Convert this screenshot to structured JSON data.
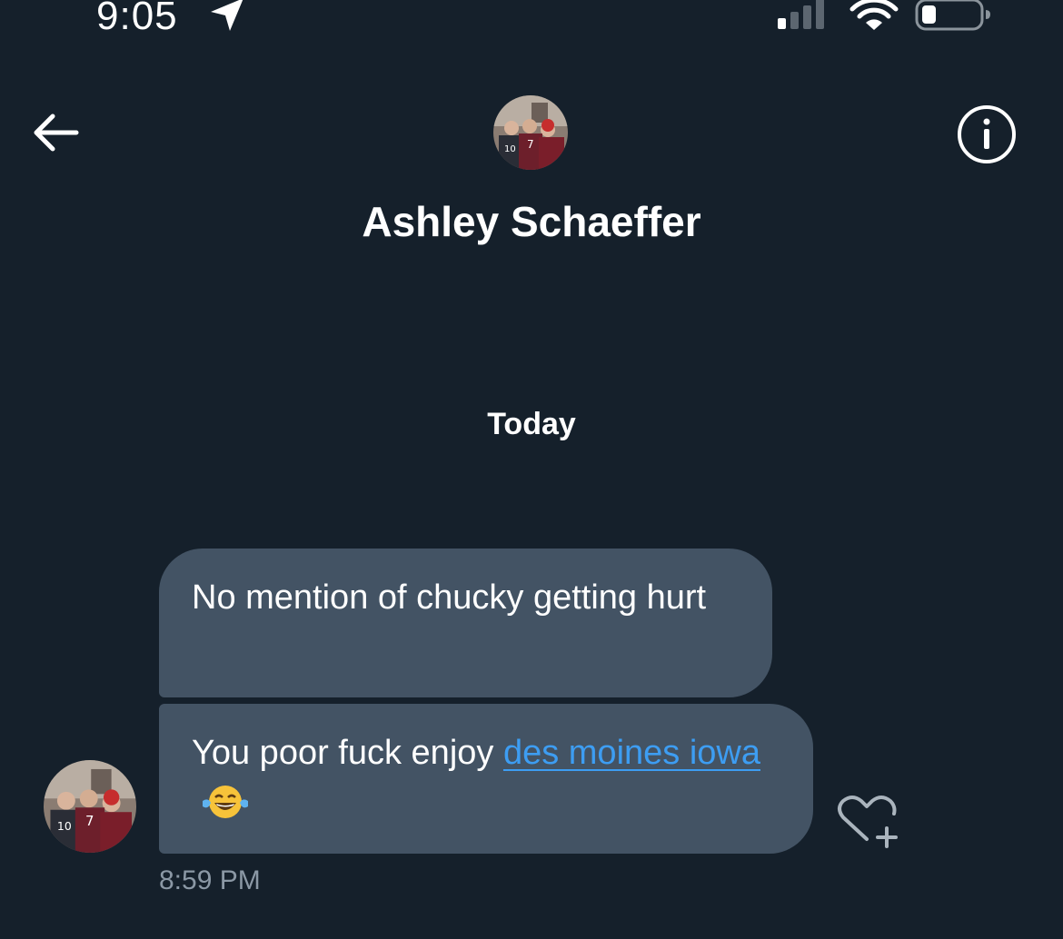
{
  "status_bar": {
    "time": "9:05",
    "location_icon": "location-arrow-icon",
    "signal_icon": "cellular-signal-icon",
    "wifi_icon": "wifi-icon",
    "battery_icon": "battery-icon",
    "battery_level": 0.2
  },
  "header": {
    "back_icon": "back-arrow-icon",
    "info_icon": "info-icon",
    "contact_name": "Ashley Schaeffer"
  },
  "conversation": {
    "date_separator": "Today",
    "messages": [
      {
        "text": "No mention of chucky getting hurt"
      },
      {
        "text_prefix": "You poor fuck enjoy ",
        "link_text": "des moines iowa",
        "emoji": "😂"
      }
    ],
    "timestamp": "8:59 PM",
    "reaction_icon": "heart-plus-icon"
  },
  "colors": {
    "background": "#15202b",
    "bubble": "#435364",
    "link": "#3d9df2",
    "timestamp": "#8b98a5"
  }
}
